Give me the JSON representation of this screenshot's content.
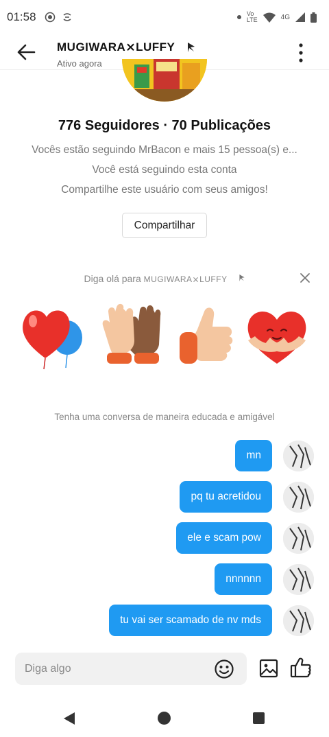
{
  "status_bar": {
    "time": "01:58",
    "network_labels": [
      "Vo",
      "LTE"
    ],
    "network_type": "4G"
  },
  "header": {
    "title": "MUGIWARA⨯LUFFY",
    "subtitle": "Ativo agora"
  },
  "profile": {
    "stats": "776 Seguidores · 70 Publicações",
    "mutual": "Vocês estão seguindo MrBacon e mais 15 pessoa(s) e...",
    "following": "Você está seguindo esta conta",
    "share_prompt": "Compartilhe este usuário com seus amigos!",
    "share_button": "Compartilhar"
  },
  "greeting": {
    "prefix": "Diga olá para ",
    "name": "MUGIWARA⨯LUFFY",
    "stickers": [
      "heart-balloons-sticker",
      "high-five-sticker",
      "thumbs-up-sticker",
      "hugging-heart-sticker"
    ]
  },
  "notice": "Tenha uma conversa de maneira educada e amigável",
  "messages": [
    {
      "text": "mn"
    },
    {
      "text": "pq tu acretidou"
    },
    {
      "text": "ele e scam pow"
    },
    {
      "text": "nnnnnn"
    },
    {
      "text": "tu vai ser scamado de nv mds"
    }
  ],
  "composer": {
    "placeholder": "Diga algo"
  },
  "colors": {
    "bubble": "#1f9af2",
    "text_muted": "#777777"
  }
}
